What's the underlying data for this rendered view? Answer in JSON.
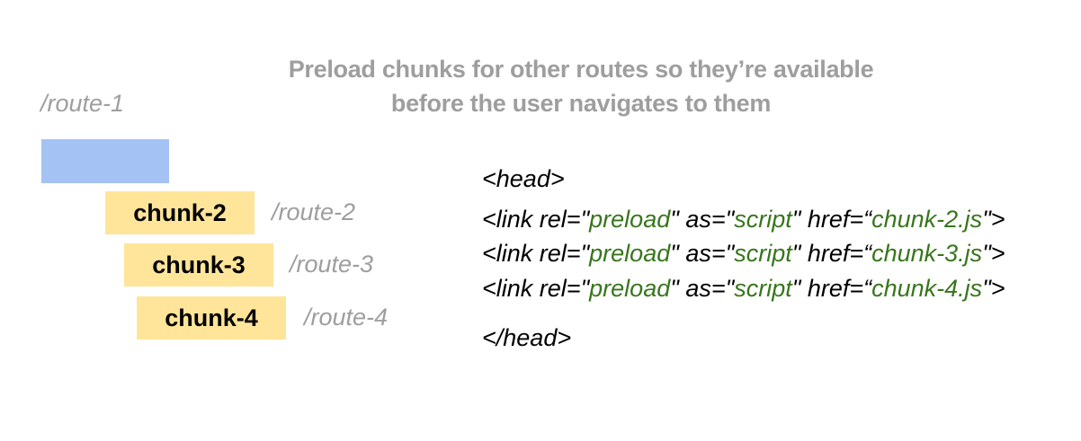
{
  "title": {
    "line1": "Preload chunks for other routes so they’re available",
    "line2": "before  the user navigates to them"
  },
  "routes": {
    "route1": "/route-1",
    "route2": "/route-2",
    "route3": "/route-3",
    "route4": "/route-4"
  },
  "chunks": {
    "chunk2": "chunk-2",
    "chunk3": "chunk-3",
    "chunk4": "chunk-4"
  },
  "code": {
    "head_open": "<head>",
    "head_close": "</head>",
    "link_prefix": "<link rel=",
    "q": "\"",
    "preload": "preload",
    "as_attr": " as=",
    "script": "script",
    "href_attr": " href=",
    "open_quote": "“",
    "close_tag": "\">",
    "files": [
      "chunk-2.js",
      "chunk-3.js",
      "chunk-4.js"
    ]
  },
  "colors": {
    "blue_bar": "#a4c2f4",
    "chunk_bar": "#ffe599",
    "muted_text": "#9e9e9e",
    "code_green": "#38761d"
  }
}
